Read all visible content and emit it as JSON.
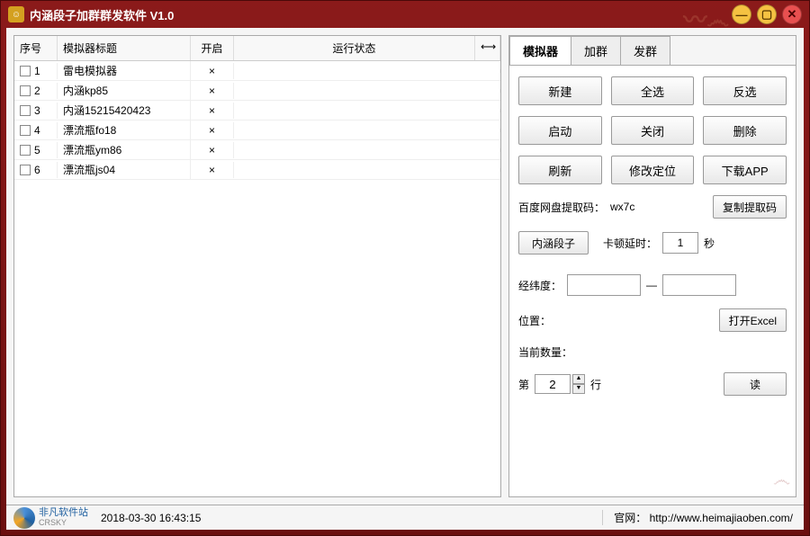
{
  "window": {
    "title": "内涵段子加群群发软件 V1.0"
  },
  "table": {
    "headers": {
      "seq": "序号",
      "title": "模拟器标题",
      "open": "开启",
      "status": "运行状态",
      "drag": "⟷"
    },
    "rows": [
      {
        "seq": "1",
        "title": "雷电模拟器",
        "open": "×"
      },
      {
        "seq": "2",
        "title": "内涵kp85",
        "open": "×"
      },
      {
        "seq": "3",
        "title": "内涵15215420423",
        "open": "×"
      },
      {
        "seq": "4",
        "title": "漂流瓶fo18",
        "open": "×"
      },
      {
        "seq": "5",
        "title": "漂流瓶ym86",
        "open": "×"
      },
      {
        "seq": "6",
        "title": "漂流瓶js04",
        "open": "×"
      }
    ]
  },
  "tabs": {
    "simulator": "模拟器",
    "addgroup": "加群",
    "sendgroup": "发群"
  },
  "buttons": {
    "new": "新建",
    "selectall": "全选",
    "invert": "反选",
    "start": "启动",
    "close": "关闭",
    "delete": "删除",
    "refresh": "刷新",
    "editloc": "修改定位",
    "downloadapp": "下载APP",
    "copycode": "复制提取码",
    "neihan": "内涵段子",
    "openexcel": "打开Excel",
    "read": "读"
  },
  "labels": {
    "baidu": "百度网盘提取码：",
    "baiducode": "wx7c",
    "delay": "卡顿延时：",
    "delayunit": "秒",
    "delayval": "1",
    "lnglat": "经纬度：",
    "dash": "—",
    "location": "位置：",
    "count": "当前数量：",
    "row_prefix": "第",
    "row_suffix": "行",
    "row_val": "2"
  },
  "statusbar": {
    "brand": "非凡软件站",
    "watermark": "CRSKY",
    "datetime": "2018-03-30 16:43:15",
    "website_label": "官网：",
    "website": "http://www.heimajiaoben.com/"
  }
}
